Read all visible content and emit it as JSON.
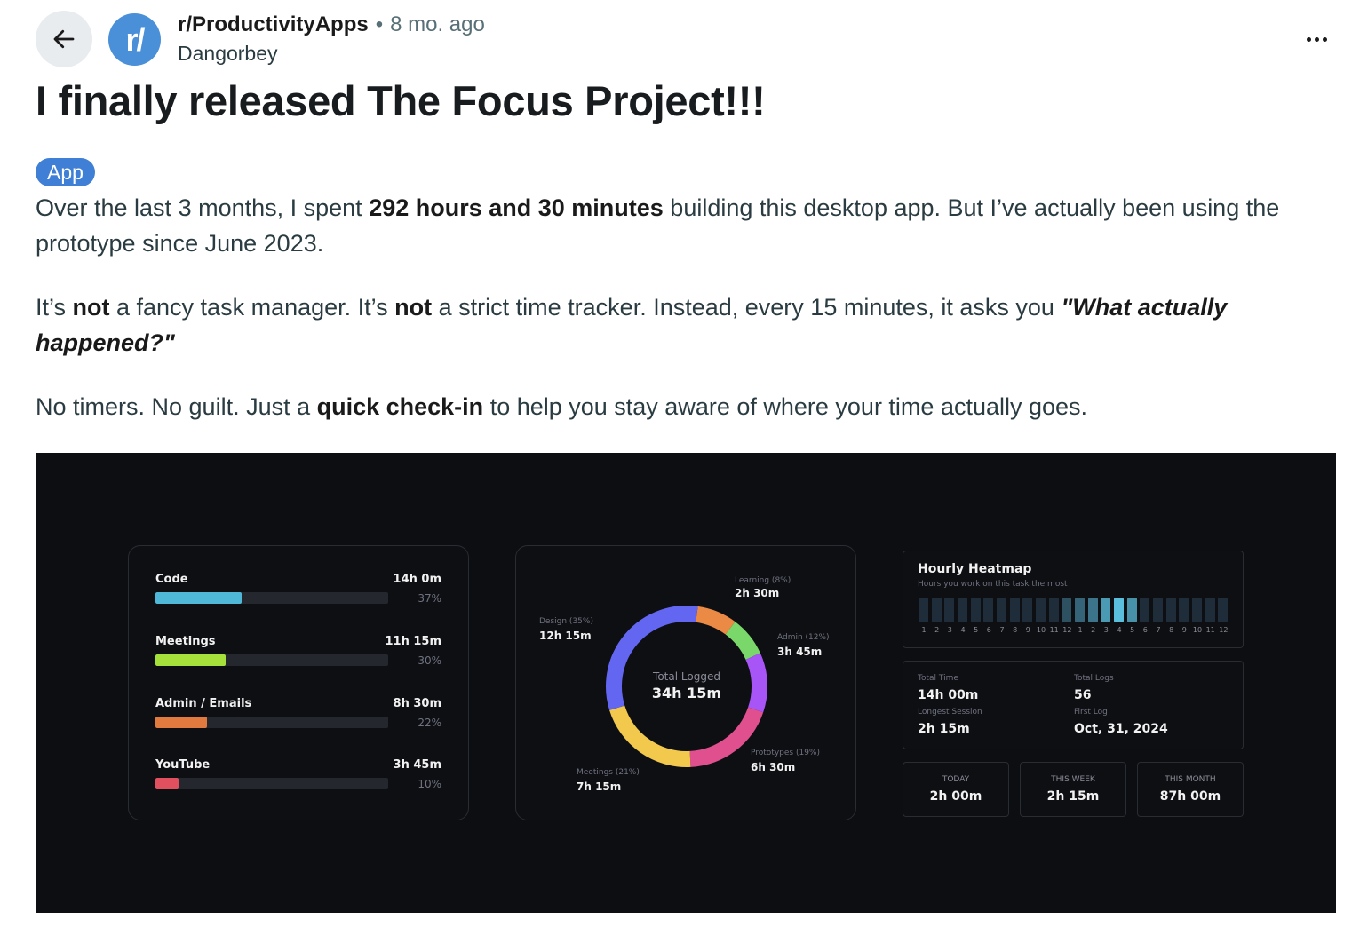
{
  "header": {
    "subreddit": "r/ProductivityApps",
    "separator": "•",
    "age": "8 mo. ago",
    "author": "Dangorbey",
    "avatar_text": "r/"
  },
  "post": {
    "title": "I finally released The Focus Project!!!",
    "flair": "App",
    "paragraphs": [
      [
        "Over the last 3 months, I spent ",
        "292 hours and 30 minutes",
        " building this desktop app. But I’ve actually been using the prototype since June 2023."
      ],
      [
        "It’s ",
        "not",
        " a fancy task manager. It’s ",
        "not",
        " a strict time tracker. Instead, every 15 minutes, it asks you ",
        "\"What actually happened?\""
      ],
      [
        "No timers. No guilt. Just a ",
        "quick check-in",
        " to help you stay aware of where your time actually goes."
      ]
    ]
  },
  "media": {
    "categories": [
      {
        "name": "Code",
        "time": "14h 0m",
        "pct": "37%",
        "fraction": 0.37,
        "color": "#4fb8d8"
      },
      {
        "name": "Meetings",
        "time": "11h 15m",
        "pct": "30%",
        "fraction": 0.3,
        "color": "#a6e03a"
      },
      {
        "name": "Admin / Emails",
        "time": "8h 30m",
        "pct": "22%",
        "fraction": 0.22,
        "color": "#e07a3f"
      },
      {
        "name": "YouTube",
        "time": "3h 45m",
        "pct": "10%",
        "fraction": 0.1,
        "color": "#e0505e"
      }
    ],
    "donut": {
      "center_label": "Total Logged",
      "center_value": "34h 15m",
      "segments": [
        {
          "label": "Learning (8%)",
          "value": "2h 30m",
          "fraction": 0.08,
          "color": "#ea8a45"
        },
        {
          "label": "",
          "value": "",
          "fraction": 0.08,
          "color": "#7ad86a"
        },
        {
          "label": "Admin (12%)",
          "value": "3h 45m",
          "fraction": 0.12,
          "color": "#a855f7"
        },
        {
          "label": "Prototypes (19%)",
          "value": "6h 30m",
          "fraction": 0.19,
          "color": "#e0508f"
        },
        {
          "label": "Meetings (21%)",
          "value": "7h 15m",
          "fraction": 0.21,
          "color": "#f2c94c"
        },
        {
          "label": "Design (35%)",
          "value": "12h 15m",
          "fraction": 0.32,
          "color": "#6366f1"
        }
      ]
    },
    "heatmap": {
      "title": "Hourly Heatmap",
      "subtitle": "Hours you work on this task the most",
      "hours": [
        "1",
        "2",
        "3",
        "4",
        "5",
        "6",
        "7",
        "8",
        "9",
        "10",
        "11",
        "12",
        "1",
        "2",
        "3",
        "4",
        "5",
        "6",
        "7",
        "8",
        "9",
        "10",
        "11",
        "12"
      ],
      "intensity": [
        0.15,
        0.15,
        0.15,
        0.15,
        0.15,
        0.15,
        0.15,
        0.15,
        0.15,
        0.15,
        0.15,
        0.35,
        0.45,
        0.55,
        0.75,
        0.95,
        0.7,
        0.15,
        0.15,
        0.15,
        0.15,
        0.15,
        0.15,
        0.15
      ]
    },
    "stats": {
      "total_time_label": "Total Time",
      "total_time": "14h 00m",
      "total_logs_label": "Total Logs",
      "total_logs": "56",
      "longest_label": "Longest Session",
      "longest": "2h 15m",
      "first_label": "First Log",
      "first": "Oct, 31, 2024"
    },
    "periods": [
      {
        "label": "TODAY",
        "value": "2h 00m"
      },
      {
        "label": "THIS WEEK",
        "value": "2h 15m"
      },
      {
        "label": "THIS MONTH",
        "value": "87h 00m"
      }
    ]
  },
  "colors": {
    "accent": "#3f7fd6",
    "avatar": "#4a90d9",
    "media_bg": "#0d0e12"
  }
}
